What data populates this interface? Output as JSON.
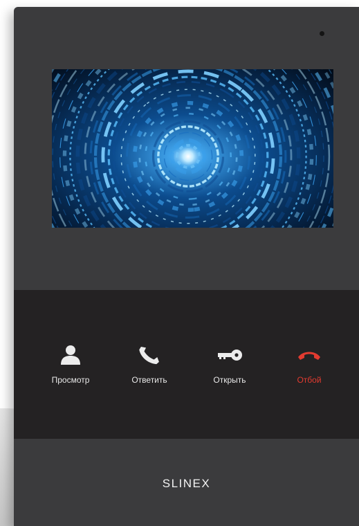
{
  "device": {
    "brand": "SLINEX",
    "controls": [
      {
        "label": "Просмотр",
        "icon": "user-icon"
      },
      {
        "label": "Ответить",
        "icon": "phone-answer-icon"
      },
      {
        "label": "Открыть",
        "icon": "key-icon"
      },
      {
        "label": "Отбой",
        "icon": "phone-hangup-icon"
      }
    ],
    "colors": {
      "body": "#3b3b3d",
      "panel": "#242223",
      "label": "#e8e8e8",
      "hangup": "#e23b30"
    }
  }
}
